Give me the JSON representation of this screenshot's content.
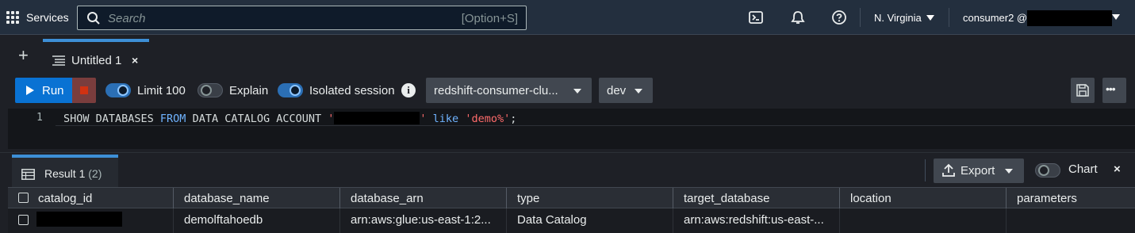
{
  "topnav": {
    "services_label": "Services",
    "search_placeholder": "Search",
    "search_shortcut": "[Option+S]",
    "region": "N. Virginia",
    "account_prefix": "consumer2 @"
  },
  "tabs": [
    {
      "label": "Untitled 1",
      "close": "×"
    }
  ],
  "add_tab": "+",
  "toolbar": {
    "run_label": "Run",
    "limit_label": "Limit 100",
    "limit_on": true,
    "explain_label": "Explain",
    "explain_on": false,
    "isolated_label": "Isolated session",
    "isolated_on": true,
    "info_glyph": "i",
    "cluster": "redshift-consumer-clu...",
    "database": "dev",
    "more_glyph": "•••"
  },
  "editor": {
    "line_number": "1",
    "code": {
      "t1": "SHOW DATABASES ",
      "kw1": "FROM",
      "t2": " DATA CATALOG ACCOUNT ",
      "q_open": "'",
      "q_close": "'",
      "kw2": " like ",
      "str": "'demo%'",
      "end": ";"
    }
  },
  "results": {
    "tab_label": "Result 1",
    "tab_count": "(2)",
    "export_label": "Export",
    "chart_label": "Chart",
    "chart_on": false,
    "close_glyph": "×",
    "columns": [
      "catalog_id",
      "database_name",
      "database_arn",
      "type",
      "target_database",
      "location",
      "parameters"
    ],
    "rows": [
      {
        "catalog_id": "",
        "database_name": "demolftahoedb",
        "database_arn": "arn:aws:glue:us-east-1:2...",
        "type": "Data Catalog",
        "target_database": "arn:aws:redshift:us-east-...",
        "location": "",
        "parameters": ""
      }
    ]
  },
  "colors": {
    "accent": "#0972d3",
    "nav_bg": "#232f3e",
    "tab_indicator": "#3d8fd6",
    "stop": "#d13212"
  }
}
